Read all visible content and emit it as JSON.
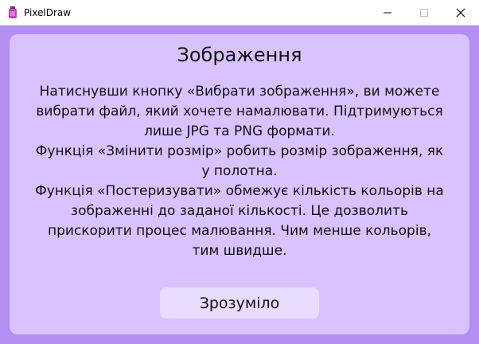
{
  "window": {
    "title": "PixelDraw",
    "controls": {
      "minimize": "—",
      "maximize": "☐",
      "close": "✕"
    }
  },
  "dialog": {
    "heading": "Зображення",
    "paragraphs": [
      "Натиснувши кнопку «Вибрати зображення», ви можете вибрати файл, який хочете намалювати. Підтримуються лише JPG та PNG формати.",
      "Функція «Змінити розмір» робить розмір зображення, як у полотна.",
      "Функція «Постеризувати» обмежує кількість кольорів на зображенні до заданої кількості. Це дозволить прискорити процес малювання. Чим менше кольорів, тим швидше."
    ],
    "ok_button": "Зрозуміло"
  },
  "colors": {
    "window_bg": "#b58ef2",
    "panel_bg": "#d8c2ff",
    "button_bg": "#e8dcff"
  }
}
